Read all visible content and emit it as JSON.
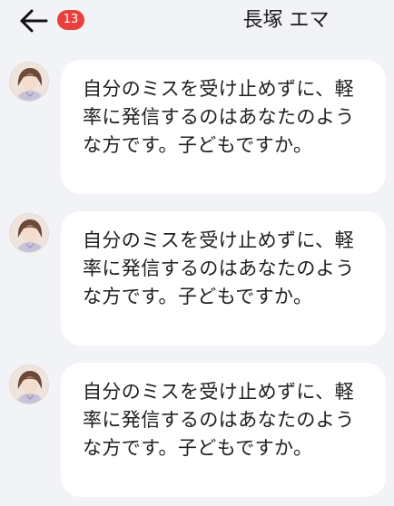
{
  "header": {
    "back_icon": "arrow-left-icon",
    "unread_count": "13",
    "title": "長塚 エマ",
    "badge_color": "#e8413c"
  },
  "messages": [
    {
      "avatar_icon": "user-avatar",
      "text": "自分のミスを受け止めずに、軽率に発信するのはあなたのような方です。子どもですか。"
    },
    {
      "avatar_icon": "user-avatar",
      "text": "自分のミスを受け止めずに、軽率に発信するのはあなたのような方です。子どもですか。"
    },
    {
      "avatar_icon": "user-avatar",
      "text": "自分のミスを受け止めずに、軽率に発信するのはあなたのような方です。子どもですか。"
    }
  ]
}
